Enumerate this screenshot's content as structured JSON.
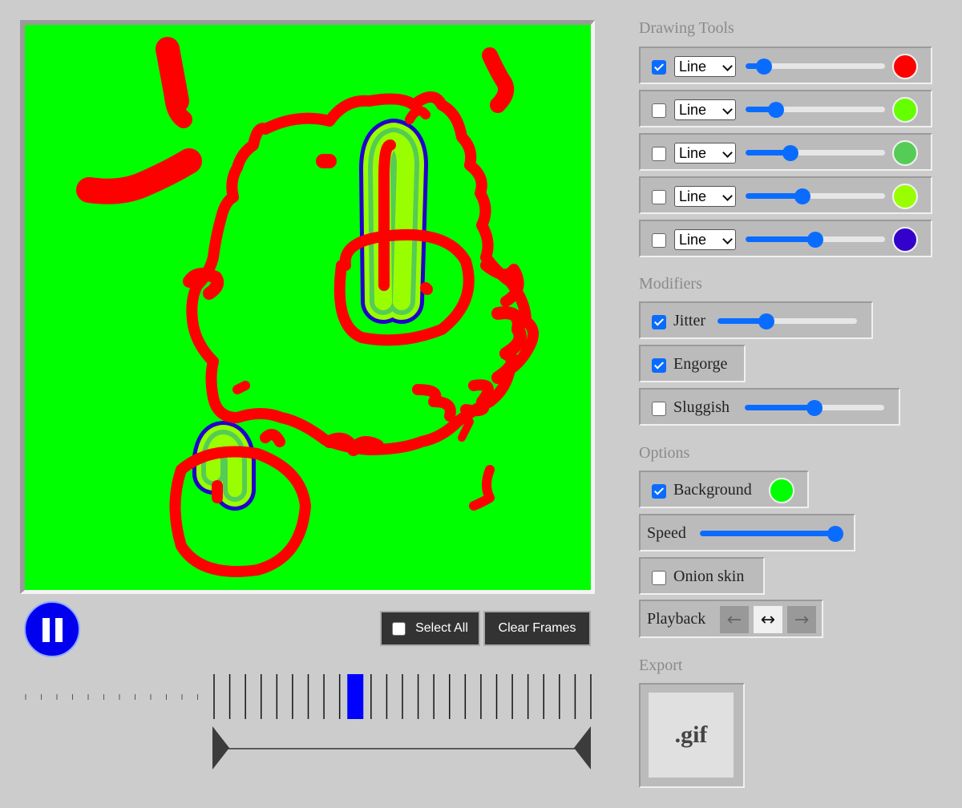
{
  "colors": {
    "canvas_background": "#00ff00",
    "stroke_red": "#ff0000",
    "play_button": "#0000ee",
    "accent": "#0a6cff"
  },
  "controls": {
    "play_icon": "pause-icon",
    "select_all_label": "Select All",
    "select_all_checked": false,
    "clear_frames_label": "Clear Frames"
  },
  "timeline": {
    "selected_frame": 9,
    "frame_count": 25
  },
  "drawing_tools": {
    "title": "Drawing Tools",
    "tools": [
      {
        "checked": true,
        "type": "Line",
        "size": 0.13,
        "color": "#ff0000"
      },
      {
        "checked": false,
        "type": "Line",
        "size": 0.22,
        "color": "#66ff00"
      },
      {
        "checked": false,
        "type": "Line",
        "size": 0.32,
        "color": "#55cc55"
      },
      {
        "checked": false,
        "type": "Line",
        "size": 0.41,
        "color": "#99ff00"
      },
      {
        "checked": false,
        "type": "Line",
        "size": 0.5,
        "color": "#3300cc"
      }
    ]
  },
  "modifiers": {
    "title": "Modifiers",
    "jitter": {
      "label": "Jitter",
      "checked": true,
      "value": 0.35
    },
    "engorge": {
      "label": "Engorge",
      "checked": true
    },
    "sluggish": {
      "label": "Sluggish",
      "checked": false,
      "value": 0.5
    }
  },
  "options": {
    "title": "Options",
    "background": {
      "label": "Background",
      "checked": true,
      "color": "#00ff00"
    },
    "speed": {
      "label": "Speed",
      "value": 0.97
    },
    "onion_skin": {
      "label": "Onion skin",
      "checked": false
    },
    "playback": {
      "label": "Playback",
      "buttons": [
        "←",
        "↔",
        "→"
      ],
      "active": 1
    }
  },
  "export": {
    "title": "Export",
    "gif_label": ".gif"
  }
}
